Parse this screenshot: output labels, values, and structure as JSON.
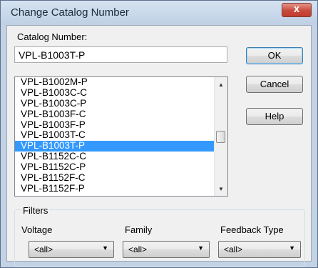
{
  "dialog": {
    "title": "Change Catalog Number",
    "close_glyph": "x"
  },
  "catalog": {
    "label": "Catalog Number:",
    "value": "VPL-B1003T-P"
  },
  "list": {
    "items": [
      "VPL-B1002M-P",
      "VPL-B1003C-C",
      "VPL-B1003C-P",
      "VPL-B1003F-C",
      "VPL-B1003F-P",
      "VPL-B1003T-C",
      "VPL-B1003T-P",
      "VPL-B1152C-C",
      "VPL-B1152C-P",
      "VPL-B1152F-C",
      "VPL-B1152F-P"
    ],
    "selected": "VPL-B1003T-P",
    "scroll_up_icon": "scroll-up-arrow",
    "scroll_down_icon": "scroll-down-arrow"
  },
  "buttons": {
    "ok": "OK",
    "cancel": "Cancel",
    "help": "Help"
  },
  "filters": {
    "title": "Filters",
    "voltage": {
      "label": "Voltage",
      "value": "<all>"
    },
    "family": {
      "label": "Family",
      "value": "<all>"
    },
    "feedback": {
      "label": "Feedback Type",
      "value": "<all>"
    }
  },
  "colors": {
    "selection": "#3399ff",
    "close_button": "#c74a3c"
  }
}
